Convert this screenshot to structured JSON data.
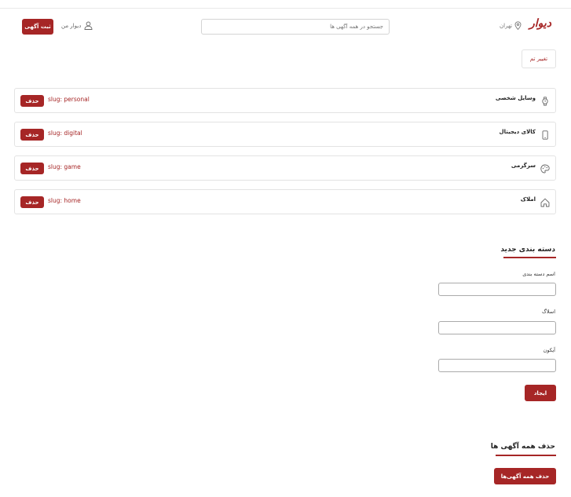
{
  "header": {
    "logo": "دیوار",
    "city": "تهران",
    "search_placeholder": "جستجو در همه آگهی ها",
    "my_divar": "دیوار من",
    "post_ad": "ثبت آگهی"
  },
  "theme_button": "تغییر تم",
  "categories": [
    {
      "name": "وسایل شخصی",
      "slug": "slug: personal",
      "icon": "watch-icon",
      "delete": "حذف"
    },
    {
      "name": "کالای دیجیتال",
      "slug": "slug: digital",
      "icon": "phone-icon",
      "delete": "حذف"
    },
    {
      "name": "سرگرمی",
      "slug": "slug: game",
      "icon": "palette-icon",
      "delete": "حذف"
    },
    {
      "name": "املاک",
      "slug": "slug: home",
      "icon": "home-icon",
      "delete": "حذف"
    }
  ],
  "new_category": {
    "title": "دسته بندی جدید",
    "name_label": "اسم دسته بندی",
    "slug_label": "اسلاگ",
    "icon_label": "آیکون",
    "create_button": "ایجاد"
  },
  "delete_all": {
    "title": "حذف همه آگهی ها",
    "button": "حذف همه آگهی‌ها"
  },
  "colors": {
    "brand": "#a62626",
    "border": "#e3e3e3"
  }
}
